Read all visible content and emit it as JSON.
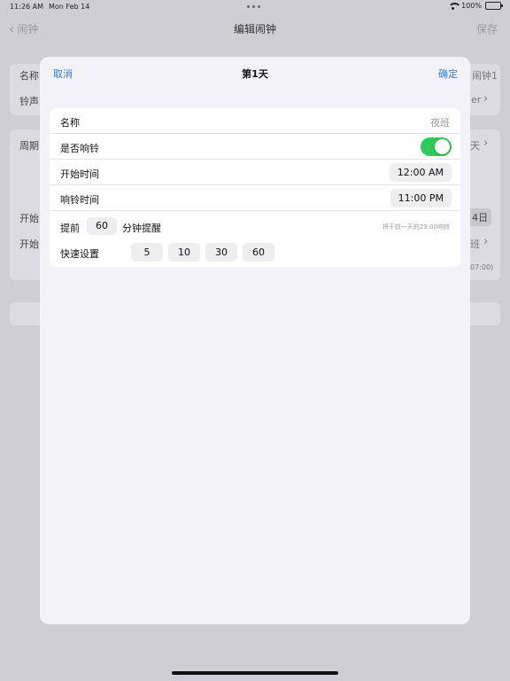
{
  "status_bar": {
    "time": "11:26 AM",
    "date": "Mon Feb 14",
    "battery": "100%"
  },
  "background": {
    "back_label": "闹钟",
    "title": "编辑闹钟",
    "save_label": "保存",
    "rows": [
      {
        "label": "名称",
        "value": "闹钟1"
      },
      {
        "label": "铃声",
        "value": "er"
      },
      {
        "label": "周期",
        "value": "天"
      },
      {
        "label": "开始",
        "value": "4日"
      },
      {
        "label": "开始",
        "value": "班"
      }
    ],
    "note": "07:00)"
  },
  "modal": {
    "cancel_label": "取消",
    "title": "第1天",
    "confirm_label": "确定",
    "name_label": "名称",
    "name_value": "夜班",
    "ring_label": "是否响铃",
    "ring_enabled": true,
    "start_label": "开始时间",
    "start_time": "12:00 AM",
    "ring_time_label": "响铃时间",
    "ring_time": "11:00 PM",
    "remind_prefix": "提前",
    "remind_minutes": "60",
    "remind_suffix": "分钟提醒",
    "remind_hint": "将于前一天的23:00响铃",
    "quick_label": "快速设置",
    "quick_options": [
      "5",
      "10",
      "30",
      "60"
    ]
  },
  "colors": {
    "accent": "#2f7fd6",
    "toggle_on": "#34c759"
  }
}
